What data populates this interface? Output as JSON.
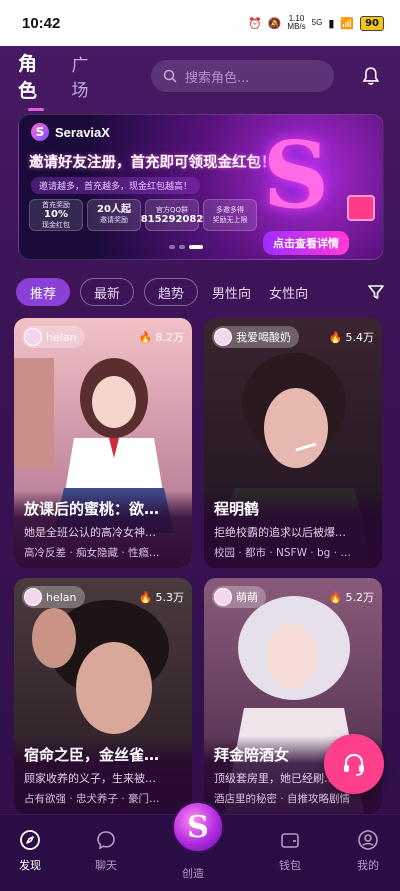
{
  "status": {
    "time": "10:42",
    "net_speed_top": "1.10",
    "net_speed_bottom": "MB/s",
    "signal": "5G",
    "battery": "90"
  },
  "header": {
    "tab_role": "角色",
    "tab_square": "广场",
    "search_placeholder": "搜索角色..."
  },
  "banner": {
    "brand": "SeraviaX",
    "headline": "邀请好友注册，首充即可领现金红包！",
    "subline": "邀请越多，首充越多，现金红包越高！",
    "chips": [
      {
        "top": "首充奖励",
        "main": "10%",
        "bottom": "现金红包"
      },
      {
        "top": "",
        "main": "20人起",
        "bottom": "邀请奖励"
      },
      {
        "top": "官方QQ群",
        "main": "815292082",
        "bottom": ""
      },
      {
        "top": "多邀多得",
        "main": "",
        "bottom": "奖励无上限"
      }
    ],
    "cta": "点击查看详情"
  },
  "filters": [
    "推荐",
    "最新",
    "趋势",
    "男性向",
    "女性向"
  ],
  "cards": [
    {
      "author": "helan",
      "views": "8.2万",
      "title": "放课后的蜜桃：欲…",
      "desc": "她是全班公认的高冷女神…",
      "tags": "高冷反差 · 痴女隐藏 · 性瘾…",
      "art": "school-girl"
    },
    {
      "author": "我爱喝酸奶",
      "views": "5.4万",
      "title": "程明鹤",
      "desc": "拒绝校霸的追求以后被爆…",
      "tags": "校园 · 都市 · NSFW · bg · …",
      "art": "smoking-guy"
    },
    {
      "author": "helan",
      "views": "5.3万",
      "title": "宿命之臣，金丝雀…",
      "desc": "顾家收养的义子，生来被…",
      "tags": "占有欲强 · 忠犬养子 · 豪门…",
      "art": "dark-guy"
    },
    {
      "author": "萌萌",
      "views": "5.2万",
      "title": "拜金陪酒女",
      "desc": "顶级套房里，她已经刷…",
      "tags": "酒店里的秘密 · 自推攻略剧情",
      "art": "silver-girl"
    }
  ],
  "nav": {
    "discover": "发现",
    "chat": "聊天",
    "create": "创造",
    "wallet": "钱包",
    "mine": "我的"
  },
  "colors": {
    "accent": "#8a3fd6",
    "pink": "#ff3f8c",
    "bg": "#3a1355"
  }
}
